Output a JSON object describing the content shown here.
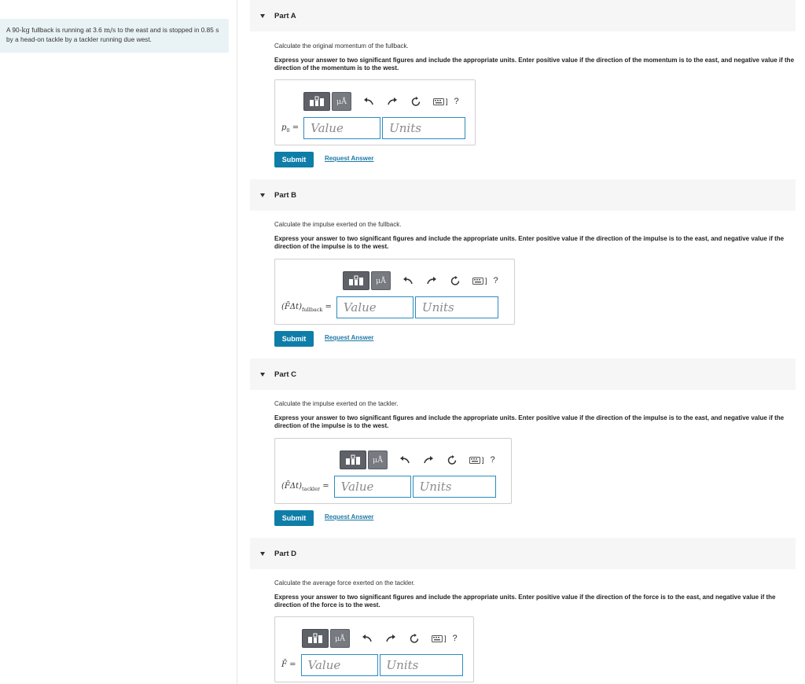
{
  "problem": {
    "text_1": "A 90-",
    "unit_kg": "kg",
    "text_2": " fullback is running at 3.6 ",
    "unit_ms": "m/s",
    "text_3": " to the east and is stopped in 0.85 ",
    "unit_s": "s",
    "text_4": " by a head-on tackle by a tackler running due west."
  },
  "toolbar": {
    "units_glyph": "μÅ",
    "help_glyph": "?",
    "kbd_glyph": "]"
  },
  "field_placeholders": {
    "value": "Value",
    "units": "Units"
  },
  "actions": {
    "submit": "Submit",
    "request_answer": "Request Answer"
  },
  "parts": [
    {
      "title": "Part A",
      "question": "Calculate the original momentum of the fullback.",
      "instruction": "Express your answer to two significant figures and include the appropriate units. Enter positive value if the direction of the momentum is to the east, and negative value if the direction of the momentum is to the west.",
      "var_main": "p",
      "var_sub": "0",
      "var_eq": " ="
    },
    {
      "title": "Part B",
      "question": "Calculate the impulse exerted on the fullback.",
      "instruction": "Express your answer to two significant figures and include the appropriate units. Enter positive value if the direction of the impulse is to the east, and negative value if the direction of the impulse is to the west.",
      "var_main": "(F̄Δt)",
      "var_sub": "fullback",
      "var_eq": " ="
    },
    {
      "title": "Part C",
      "question": "Calculate the impulse exerted on the tackler.",
      "instruction": "Express your answer to two significant figures and include the appropriate units. Enter positive value if the direction of the impulse is to the east, and negative value if the direction of the impulse is to the west.",
      "var_main": "(F̄Δt)",
      "var_sub": "tackler",
      "var_eq": " ="
    },
    {
      "title": "Part D",
      "question": "Calculate the average force exerted on the tackler.",
      "instruction": "Express your answer to two significant figures and include the appropriate units. Enter positive value if the direction of the force is to the east, and negative value if the direction of the force is to the west.",
      "var_main": "F̄",
      "var_sub": "",
      "var_eq": " ="
    }
  ]
}
